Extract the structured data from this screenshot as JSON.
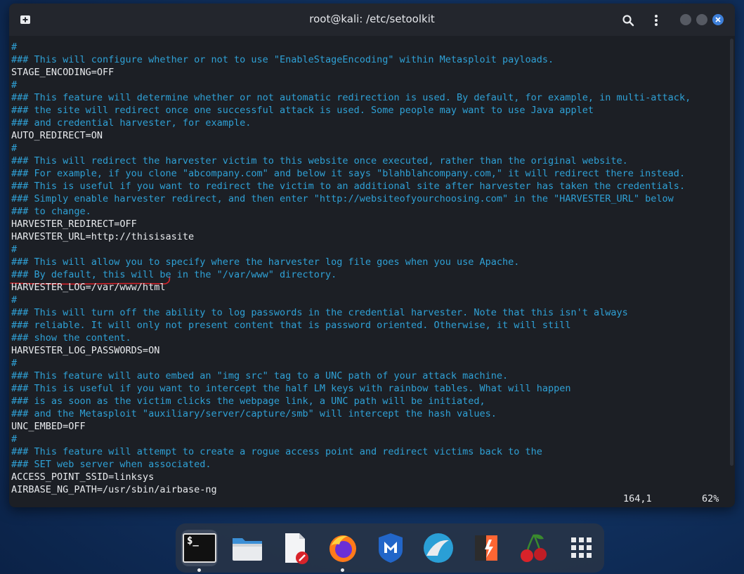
{
  "window": {
    "title": "root@kali: /etc/setoolkit",
    "icons": [
      "new-tab-icon",
      "search-icon",
      "kebab-menu-icon",
      "minimize-icon",
      "maximize-icon",
      "close-icon"
    ],
    "accent_color": "#3d7fd9"
  },
  "terminal": {
    "comment_color": "#2fa1d6",
    "text_color": "#e9ebee",
    "lines": [
      {
        "kind": "comment",
        "text": "#"
      },
      {
        "kind": "comment",
        "text": "### This will configure whether or not to use \"EnableStageEncoding\" within Metasploit payloads."
      },
      {
        "kind": "setting",
        "text": "STAGE_ENCODING=OFF"
      },
      {
        "kind": "comment",
        "text": "#"
      },
      {
        "kind": "comment",
        "text": "### This feature will determine whether or not automatic redirection is used. By default, for example, in multi-attack,"
      },
      {
        "kind": "comment",
        "text": "### the site will redirect once one successful attack is used. Some people may want to use Java applet"
      },
      {
        "kind": "comment",
        "text": "### and credential harvester, for example."
      },
      {
        "kind": "setting",
        "text": "AUTO_REDIRECT=ON"
      },
      {
        "kind": "comment",
        "text": "#"
      },
      {
        "kind": "comment",
        "text": "### This will redirect the harvester victim to this website once executed, rather than the original website."
      },
      {
        "kind": "comment",
        "text": "### For example, if you clone \"abcompany.com\" and below it says \"blahblahcompany.com,\" it will redirect there instead."
      },
      {
        "kind": "comment",
        "text": "### This is useful if you want to redirect the victim to an additional site after harvester has taken the credentials."
      },
      {
        "kind": "comment",
        "text": "### Simply enable harvester redirect, and then enter \"http://websiteofyourchoosing.com\" in the \"HARVESTER_URL\" below"
      },
      {
        "kind": "comment",
        "text": "### to change."
      },
      {
        "kind": "setting",
        "text": "HARVESTER_REDIRECT=OFF"
      },
      {
        "kind": "setting",
        "text": "HARVESTER_URL=http://thisisasite"
      },
      {
        "kind": "comment",
        "text": "#"
      },
      {
        "kind": "comment",
        "text": "### This will allow you to specify where the harvester log file goes when you use Apache."
      },
      {
        "kind": "comment",
        "text": "### By default, this will be in the \"/var/www\" directory."
      },
      {
        "kind": "setting",
        "text": "HARVESTER_LOG=/var/www/html",
        "underlined": true
      },
      {
        "kind": "comment",
        "text": "#"
      },
      {
        "kind": "comment",
        "text": "### This will turn off the ability to log passwords in the credential harvester. Note that this isn't always"
      },
      {
        "kind": "comment",
        "text": "### reliable. It will only not present content that is password oriented. Otherwise, it will still"
      },
      {
        "kind": "comment",
        "text": "### show the content."
      },
      {
        "kind": "setting",
        "text": "HARVESTER_LOG_PASSWORDS=ON"
      },
      {
        "kind": "comment",
        "text": "#"
      },
      {
        "kind": "comment",
        "text": "### This feature will auto embed an \"img src\" tag to a UNC path of your attack machine."
      },
      {
        "kind": "comment",
        "text": "### This is useful if you want to intercept the half LM keys with rainbow tables. What will happen"
      },
      {
        "kind": "comment",
        "text": "### is as soon as the victim clicks the webpage link, a UNC path will be initiated,"
      },
      {
        "kind": "comment",
        "text": "### and the Metasploit \"auxiliary/server/capture/smb\" will intercept the hash values."
      },
      {
        "kind": "setting",
        "text": "UNC_EMBED=OFF"
      },
      {
        "kind": "comment",
        "text": "#"
      },
      {
        "kind": "comment",
        "text": "### This feature will attempt to create a rogue access point and redirect victims back to the"
      },
      {
        "kind": "comment",
        "text": "### SET web server when associated."
      },
      {
        "kind": "setting",
        "text": "ACCESS_POINT_SSID=linksys"
      },
      {
        "kind": "setting",
        "text": "AIRBASE_NG_PATH=/usr/sbin/airbase-ng"
      }
    ],
    "status": {
      "cursor": "164,1",
      "percent": "62%"
    },
    "annotation_color": "#d8232a"
  },
  "dock": {
    "items": [
      {
        "name": "terminal",
        "icon": "terminal-icon",
        "glyph": "$_",
        "active": true,
        "running": true
      },
      {
        "name": "files",
        "icon": "folder-icon",
        "active": false,
        "running": false
      },
      {
        "name": "text-editor",
        "icon": "text-editor-icon",
        "active": false,
        "running": false
      },
      {
        "name": "firefox",
        "icon": "firefox-icon",
        "active": false,
        "running": true
      },
      {
        "name": "metasploit",
        "icon": "metasploit-icon",
        "active": false,
        "running": false
      },
      {
        "name": "wireshark",
        "icon": "wireshark-icon",
        "active": false,
        "running": false
      },
      {
        "name": "burpsuite",
        "icon": "burpsuite-icon",
        "active": false,
        "running": false
      },
      {
        "name": "cherrytree",
        "icon": "cherrytree-icon",
        "active": false,
        "running": false
      },
      {
        "name": "app-grid",
        "icon": "app-grid-icon",
        "active": false,
        "running": false
      }
    ]
  }
}
